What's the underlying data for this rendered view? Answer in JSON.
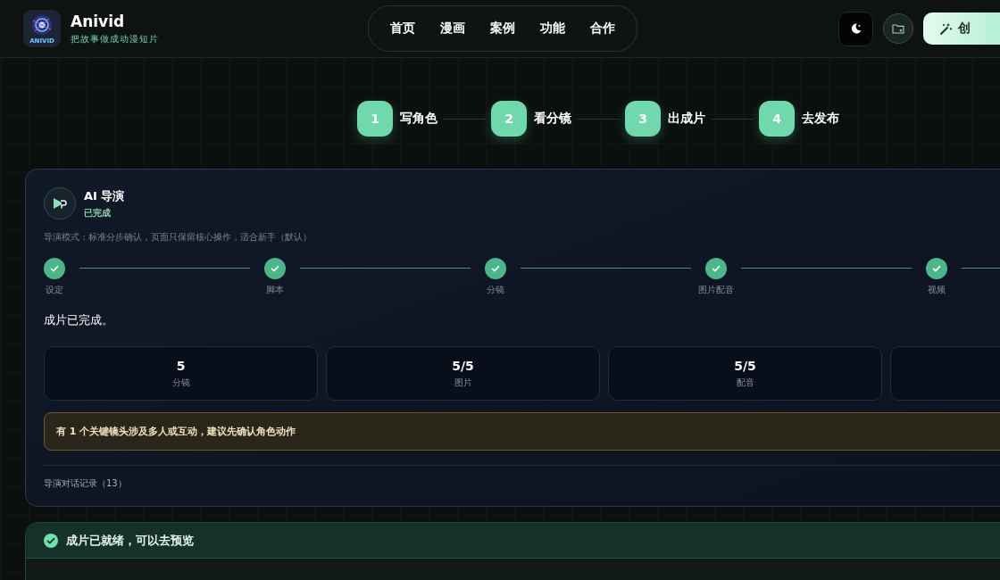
{
  "brand": {
    "logo_text": "ANIVID",
    "name": "Anivid",
    "tagline": "把故事做成动漫短片"
  },
  "nav": [
    {
      "label": "首页",
      "selected": false
    },
    {
      "label": "漫画",
      "selected": false
    },
    {
      "label": "案例",
      "selected": false
    },
    {
      "label": "功能",
      "selected": false
    },
    {
      "label": "合作",
      "selected": false
    }
  ],
  "actions": {
    "create_label": "创"
  },
  "flow_steps": [
    {
      "number": "1",
      "label": "写角色"
    },
    {
      "number": "2",
      "label": "看分镜"
    },
    {
      "number": "3",
      "label": "出成片"
    },
    {
      "number": "4",
      "label": "去发布"
    }
  ],
  "director": {
    "title": "AI 导演",
    "status": "已完成",
    "mode": "导演模式：标准分步确认，页面只保留核心操作，适合新手（默认）",
    "progress": [
      {
        "label": "设定",
        "done": true
      },
      {
        "label": "脚本",
        "done": true
      },
      {
        "label": "分镜",
        "done": true
      },
      {
        "label": "图片配音",
        "done": true
      },
      {
        "label": "视频",
        "done": true
      }
    ],
    "message": "成片已完成。",
    "stats": [
      {
        "value": "5",
        "label": "分镜"
      },
      {
        "value": "5/5",
        "label": "图片"
      },
      {
        "value": "5/5",
        "label": "配音"
      }
    ],
    "warning": "有 1 个关键镜头涉及多人或互动，建议先确认角色动作",
    "history": "导演对话记录（13）"
  },
  "ready": {
    "title": "成片已就绪，可以去预览"
  }
}
